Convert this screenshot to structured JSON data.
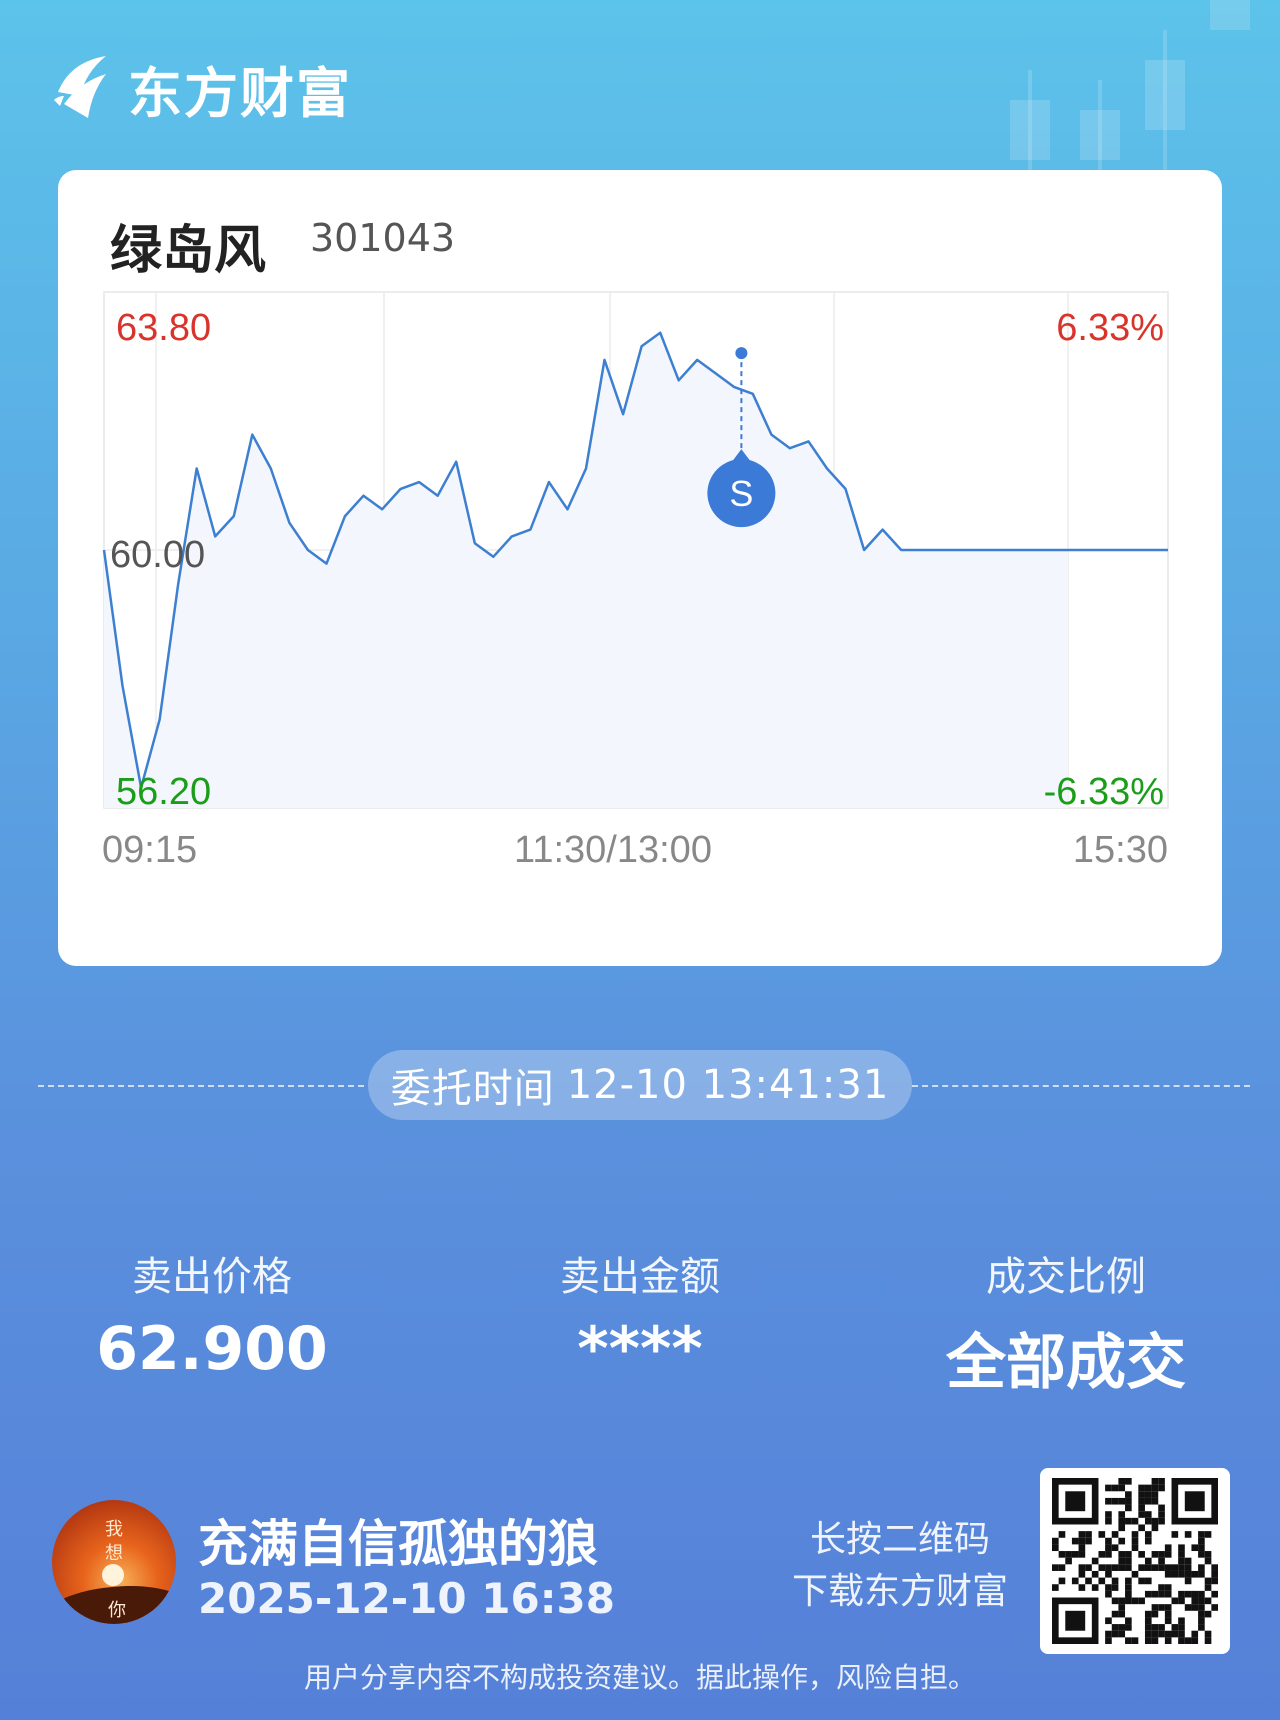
{
  "brand": {
    "name": "东方财富",
    "logo_icon": "dongfang-logo-icon"
  },
  "stock": {
    "name": "绿岛风",
    "code": "301043"
  },
  "chart_data": {
    "type": "line",
    "title": "",
    "ylim": [
      56.2,
      63.8
    ],
    "reference_price": 60.0,
    "y_labels": {
      "top": "63.80",
      "mid": "60.00",
      "bottom": "56.20"
    },
    "pct_labels": {
      "top": "6.33%",
      "bottom": "-6.33%"
    },
    "x_labels": [
      "09:15",
      "11:30/13:00",
      "15:30"
    ],
    "series": [
      {
        "x": [
          "09:15",
          "09:20",
          "09:25",
          "09:30",
          "09:35",
          "09:40",
          "09:45",
          "09:50",
          "09:55",
          "10:00",
          "10:05",
          "10:10",
          "10:15",
          "10:20",
          "10:25",
          "10:30",
          "10:35",
          "10:40",
          "10:45",
          "10:50",
          "10:55",
          "11:00",
          "11:05",
          "11:10",
          "11:15",
          "11:20",
          "11:25",
          "11:30",
          "13:00",
          "13:05",
          "13:10",
          "13:15",
          "13:20",
          "13:25",
          "13:30",
          "13:35",
          "13:40",
          "13:45",
          "13:50",
          "13:55",
          "14:00",
          "14:05",
          "14:10",
          "14:15",
          "14:20",
          "14:25",
          "14:30",
          "14:35",
          "14:40",
          "14:45",
          "14:50",
          "14:55",
          "15:00"
        ],
        "values": [
          60.0,
          58.0,
          56.5,
          57.5,
          59.5,
          61.2,
          60.2,
          60.5,
          61.7,
          61.2,
          60.4,
          60.0,
          59.8,
          60.5,
          60.8,
          60.6,
          60.9,
          61.0,
          60.8,
          61.3,
          60.1,
          59.9,
          60.2,
          60.3,
          61.0,
          60.6,
          61.2,
          62.8,
          62.0,
          63.0,
          63.2,
          62.5,
          62.8,
          62.6,
          62.4,
          62.3,
          61.7,
          61.5,
          61.6,
          61.2,
          60.9,
          60.0,
          60.3,
          60.0,
          60.0,
          60.0,
          60.0,
          60.0,
          60.0,
          60.0,
          60.0,
          60.0,
          60.0
        ]
      }
    ],
    "sell_marker": {
      "label": "S",
      "price": 62.9,
      "time": "13:41"
    }
  },
  "order": {
    "label": "委托时间",
    "datetime": "12-10 13:41:31"
  },
  "stats": [
    {
      "label": "卖出价格",
      "value": "62.900"
    },
    {
      "label": "卖出金额",
      "value": "****"
    },
    {
      "label": "成交比例",
      "value": "全部成交"
    }
  ],
  "user": {
    "name": "充满自信孤独的狼",
    "time": "2025-12-10 16:38",
    "avatar_text": "我想你"
  },
  "qr": {
    "hint_line1": "长按二维码",
    "hint_line2": "下载东方财富"
  },
  "disclaimer": "用户分享内容不构成投资建议。据此操作，风险自担。",
  "colors": {
    "up": "#d9342b",
    "down": "#1a9e1a",
    "line": "#3d7fd0",
    "marker": "#3b7ad6"
  }
}
